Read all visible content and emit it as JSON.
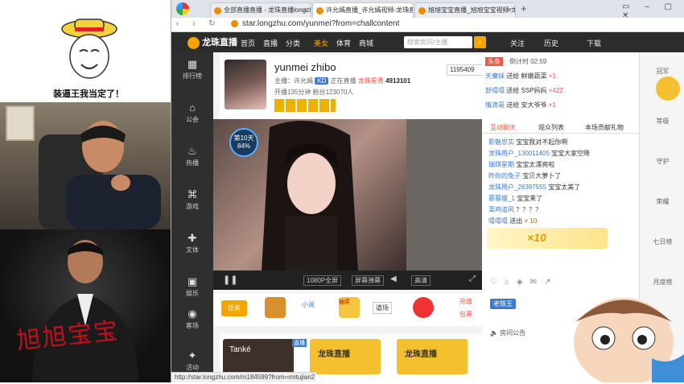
{
  "overlay": {
    "meme_caption": "装逼王我当定了！",
    "signature": "旭旭宝宝"
  },
  "browser": {
    "tabs": [
      {
        "label": "全部直播直播 - 龙珠直播longzhu"
      },
      {
        "label": "许允嫣直播_许允嫣视频-龙珠直"
      },
      {
        "label": "旭旭宝宝直播_旭旭宝宝视频-龙珠"
      }
    ],
    "address": "star.longzhu.com/yunmei?from=challcontent"
  },
  "site": {
    "logo": "龙珠直播",
    "nav": [
      "首页",
      "直播",
      "分类",
      "美女",
      "体育",
      "商城"
    ],
    "search_placeholder": "搜索房间/主播",
    "header_right": [
      "关注",
      "历史",
      "下载"
    ],
    "sidebar": [
      "排行榜",
      "公会",
      "热播",
      "游戏",
      "文体",
      "娱乐",
      "客场",
      "活动"
    ]
  },
  "streamer": {
    "name": "yunmei zhibo",
    "anchor_label": "主播：许允嫣",
    "level": "KD",
    "status": "正在直播",
    "category": "龙珠星秀",
    "fans": "4913101",
    "room": "1195409",
    "stats": "开播135分钟 粉丝123070人"
  },
  "video": {
    "rank_label": "第10天",
    "rank_pct": "84%",
    "controls": [
      "1080P全屏",
      "屏幕弹幕",
      "高清"
    ]
  },
  "feed": {
    "header": "头条",
    "timer": "倒计时 02:59",
    "rows": [
      {
        "user": "天魔妹",
        "action": "送给 鲜嫩蔬菜",
        "count": "×1"
      },
      {
        "user": "舒嘻嘻",
        "action": "送给 SSP妈妈",
        "count": "×422"
      },
      {
        "user": "情滴哥",
        "action": "送给 安大爷爷",
        "count": "×1"
      }
    ]
  },
  "chat": {
    "tabs": [
      "互动聊天",
      "观众列表",
      "本场贡献礼物"
    ],
    "messages": [
      {
        "user": "影魅忠实",
        "text": "宝宝我对不起你啊"
      },
      {
        "user": "龙珠用户_130011405",
        "text": "宝宝大家空降"
      },
      {
        "user": "瑞琪星期",
        "text": "宝宝太漂亮啦"
      },
      {
        "user": "昨你的兔子",
        "text": "宝贝大萝卜了"
      },
      {
        "user": "龙珠用户_26397555",
        "text": "宝宝太美了"
      },
      {
        "user": "慕蓉雄_1",
        "text": "宝宝来了"
      },
      {
        "user": "菜鸡追风",
        "text": "？？？？"
      },
      {
        "user": "嘻嘻嘻",
        "text": "送出",
        "count": "× 10"
      }
    ],
    "gift_banner": "×10",
    "badge": "老铁王",
    "notice": "房间公告"
  },
  "bottom": {
    "items": [
      "任务",
      "小说",
      "抽奖",
      "道场",
      "充值",
      "包裹"
    ],
    "banners": [
      "Tanké",
      "龙珠直播",
      "龙珠直播"
    ],
    "live_tag": "直播",
    "status_url": "http://star.longzhu.com/m184599?from=rmtujian2"
  },
  "right_rail": [
    "冠军",
    "等级",
    "守护",
    "荣耀",
    "七日榜",
    "月度榜"
  ]
}
